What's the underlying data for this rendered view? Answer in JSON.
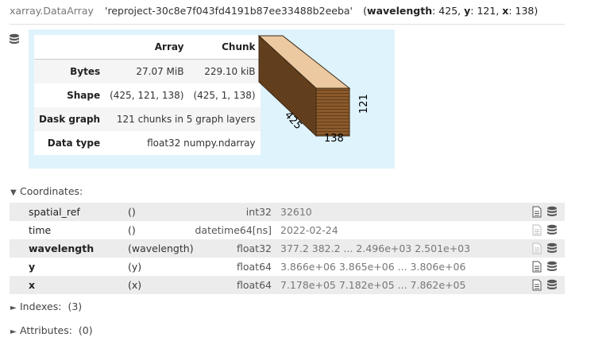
{
  "header": {
    "type_label": "xarray.DataArray",
    "name": "'reproject-30c8e7f043fd4191b87ee33488b2eeba'",
    "dims": [
      {
        "name": "wavelength",
        "size": "425"
      },
      {
        "name": "y",
        "size": "121"
      },
      {
        "name": "x",
        "size": "138"
      }
    ]
  },
  "icons": {
    "data_repr": "database-icon",
    "attrs": "file-text-icon",
    "data": "database-icon"
  },
  "dask_table": {
    "col_array": "Array",
    "col_chunk": "Chunk",
    "rows": [
      {
        "label": "Bytes",
        "array": "27.07 MiB",
        "chunk": "229.10 kiB"
      },
      {
        "label": "Shape",
        "array": "(425, 121, 138)",
        "chunk": "(425, 1, 138)"
      },
      {
        "label": "Dask graph",
        "value": "121 chunks in 5 graph layers"
      },
      {
        "label": "Data type",
        "value": "float32 numpy.ndarray"
      }
    ]
  },
  "cube": {
    "label_depth": "425",
    "label_height": "121",
    "label_width": "138",
    "colors": {
      "top": "#ecc9a0",
      "front": "#8b5a2b",
      "side": "#6b4420"
    }
  },
  "sections": {
    "coordinates": {
      "label": "Coordinates:",
      "expanded": true
    },
    "indexes": {
      "label": "Indexes:",
      "count": "(3)",
      "expanded": false
    },
    "attributes": {
      "label": "Attributes:",
      "count": "(0)",
      "expanded": false
    }
  },
  "coordinates": [
    {
      "name": "spatial_ref",
      "dims": "()",
      "dtype": "int32",
      "preview": "32610",
      "is_index": false,
      "attrs_enabled": true
    },
    {
      "name": "time",
      "dims": "()",
      "dtype": "datetime64[ns]",
      "preview": "2022-02-24",
      "is_index": false,
      "attrs_enabled": false
    },
    {
      "name": "wavelength",
      "dims": "(wavelength)",
      "dtype": "float32",
      "preview": "377.2 382.2 ... 2.496e+03 2.501e+03",
      "is_index": true,
      "attrs_enabled": false
    },
    {
      "name": "y",
      "dims": "(y)",
      "dtype": "float64",
      "preview": "3.866e+06 3.865e+06 ... 3.806e+06",
      "is_index": true,
      "attrs_enabled": true
    },
    {
      "name": "x",
      "dims": "(x)",
      "dtype": "float64",
      "preview": "7.178e+05 7.182e+05 ... 7.862e+05",
      "is_index": true,
      "attrs_enabled": true
    }
  ]
}
